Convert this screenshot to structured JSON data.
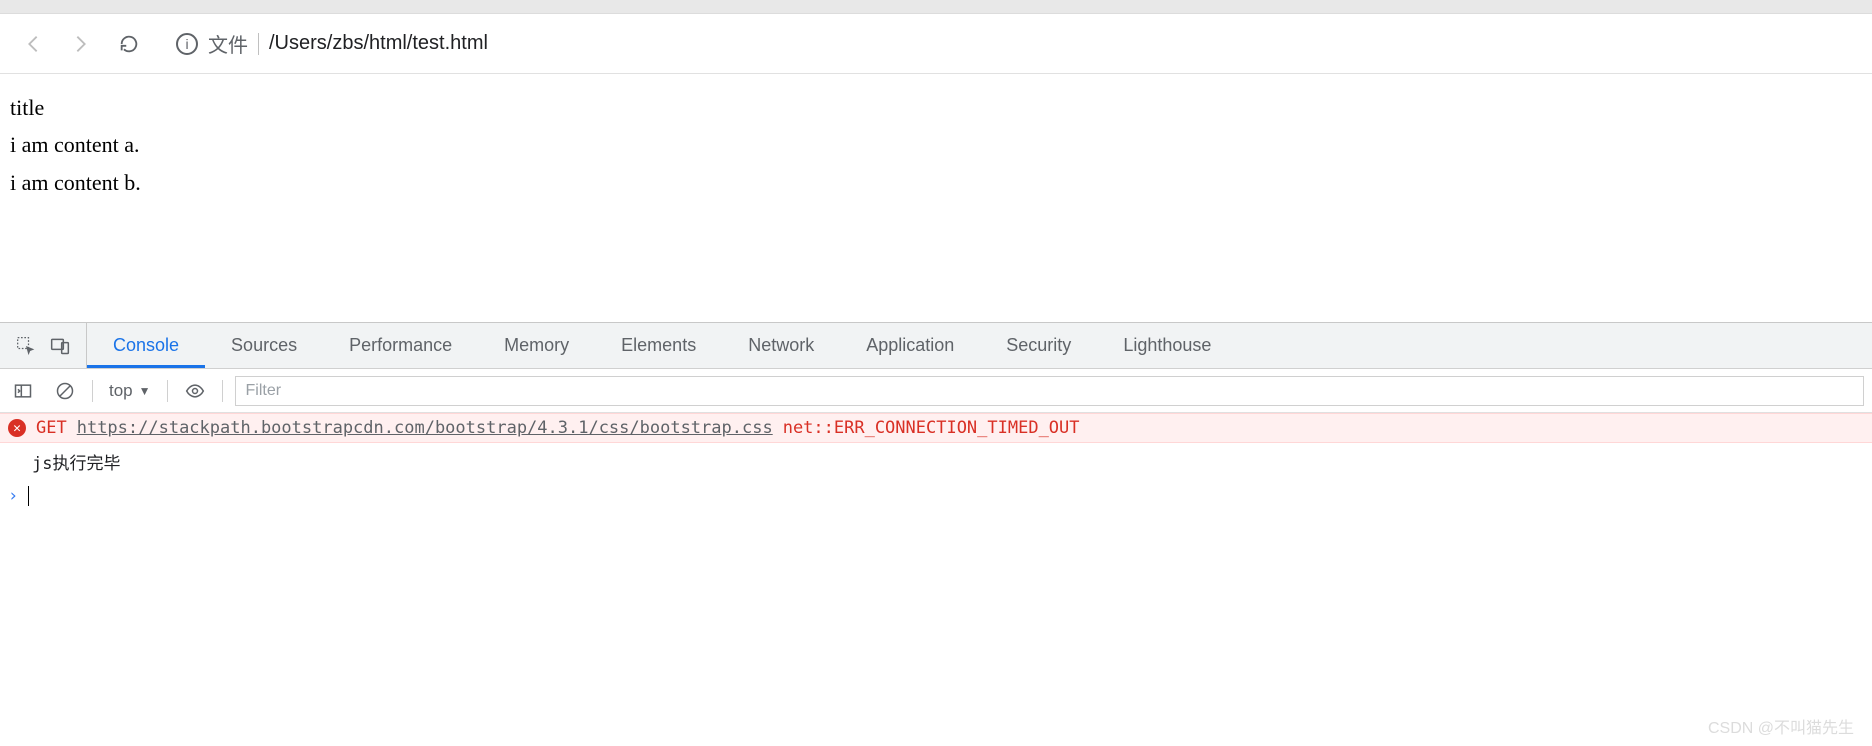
{
  "browser": {
    "address_label": "文件",
    "address_path": "/Users/zbs/html/test.html"
  },
  "page": {
    "line1": "title",
    "line2": "i am content a.",
    "line3": "i am content b."
  },
  "devtools": {
    "tabs": [
      "Console",
      "Sources",
      "Performance",
      "Memory",
      "Elements",
      "Network",
      "Application",
      "Security",
      "Lighthouse"
    ],
    "active_tab": "Console"
  },
  "console_toolbar": {
    "context": "top",
    "filter_placeholder": "Filter"
  },
  "console": {
    "error_method": "GET",
    "error_url": "https://stackpath.bootstrapcdn.com/bootstrap/4.3.1/css/bootstrap.css",
    "error_status": "net::ERR_CONNECTION_TIMED_OUT",
    "log_message": "js执行完毕",
    "prompt": "›"
  },
  "watermark": "CSDN @不叫猫先生"
}
